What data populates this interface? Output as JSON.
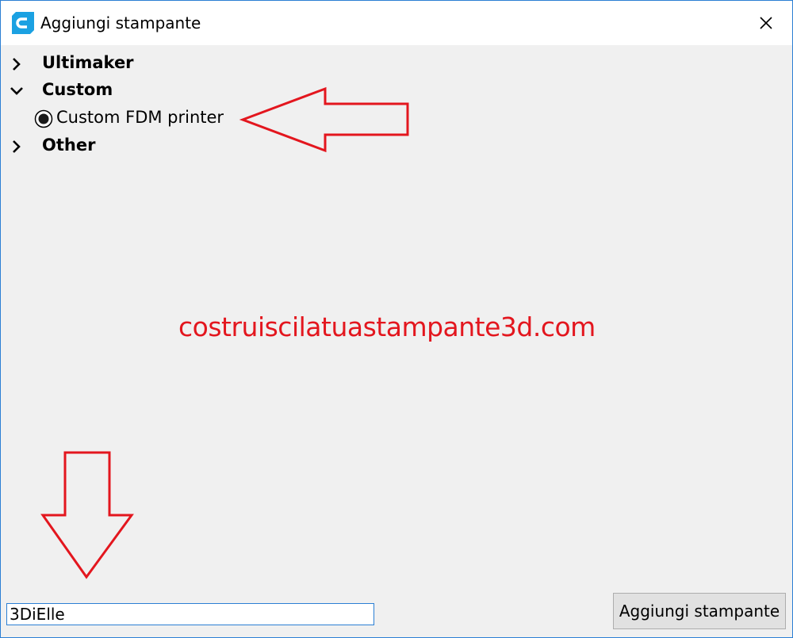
{
  "window": {
    "title": "Aggiungi stampante",
    "app_icon": "cura-logo-icon",
    "close_icon": "close-icon"
  },
  "tree": {
    "categories": [
      {
        "label": "Ultimaker",
        "expanded": false,
        "icon": "chevron-right-icon"
      },
      {
        "label": "Custom",
        "expanded": true,
        "icon": "chevron-down-icon",
        "items": [
          {
            "label": "Custom FDM printer",
            "selected": true
          }
        ]
      },
      {
        "label": "Other",
        "expanded": false,
        "icon": "chevron-right-icon"
      }
    ]
  },
  "watermark": "costruiscilatuastampante3d.com",
  "annotations": {
    "arrow_color": "#e3161e",
    "arrows": [
      "left-arrow pointing at Custom FDM printer",
      "down-arrow pointing at printer name field"
    ]
  },
  "footer": {
    "printer_name_value": "3DiElle",
    "add_button_label": "Aggiungi stampante"
  },
  "colors": {
    "accent": "#2b7fd4",
    "icon_blue": "#1ba1e2",
    "annotation_red": "#e3161e"
  }
}
